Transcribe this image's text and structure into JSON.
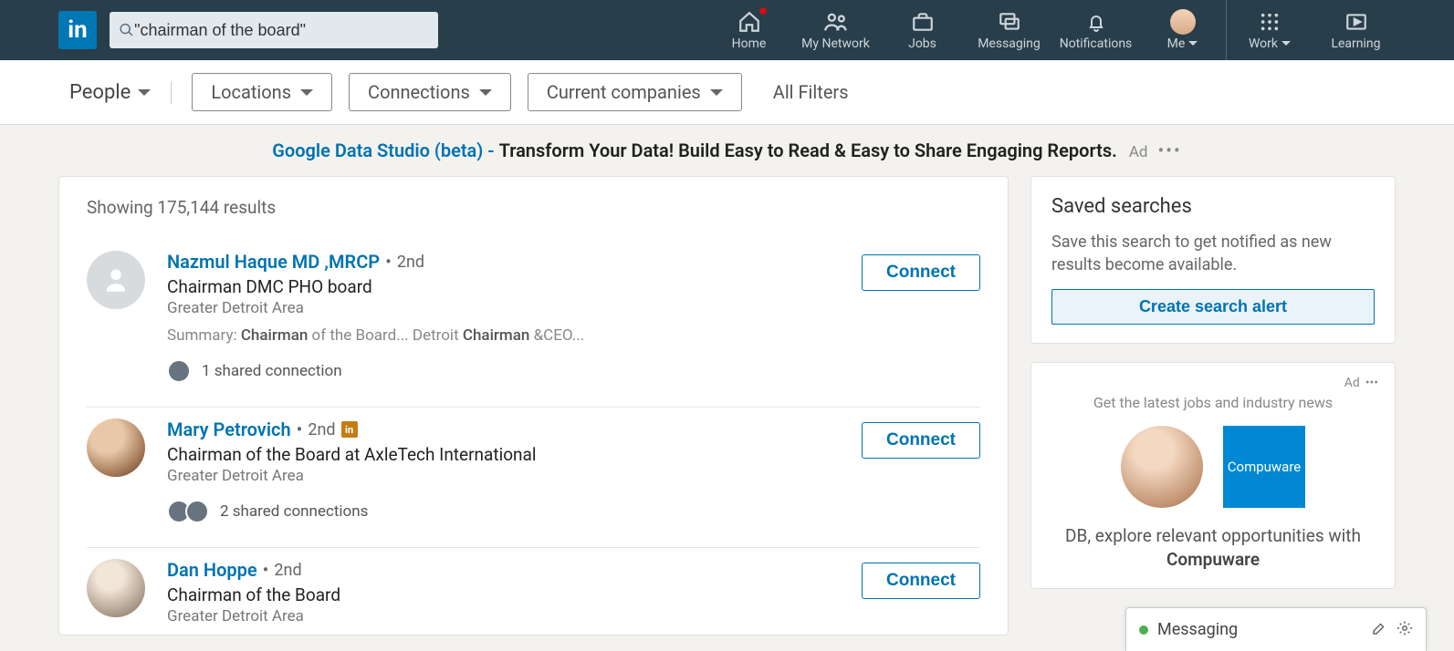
{
  "logo_text": "in",
  "search": {
    "value": "\"chairman of the board\""
  },
  "nav": {
    "home": "Home",
    "network": "My Network",
    "jobs": "Jobs",
    "messaging": "Messaging",
    "notifications": "Notifications",
    "me": "Me",
    "work": "Work",
    "learning": "Learning"
  },
  "filters": {
    "primary": "People",
    "pills": [
      "Locations",
      "Connections",
      "Current companies"
    ],
    "all": "All Filters"
  },
  "ad_strip": {
    "link": "Google Data Studio (beta) -",
    "text": " Transform Your Data! Build Easy to Read & Easy to Share Engaging Reports.",
    "tag": "Ad"
  },
  "results_header": "Showing 175,144 results",
  "connect_label": "Connect",
  "results": [
    {
      "name": "Nazmul Haque MD ,MRCP",
      "degree": "2nd",
      "headline": "Chairman DMC PHO board",
      "location": "Greater Detroit Area",
      "summary_prefix": "Summary: ",
      "summary_b1": "Chairman",
      "summary_mid": " of the Board... Detroit ",
      "summary_b2": "Chairman",
      "summary_suffix": " &CEO...",
      "shared": "1 shared connection",
      "shared_count": 1,
      "premium": false,
      "photo": false
    },
    {
      "name": "Mary Petrovich",
      "degree": "2nd",
      "headline": "Chairman of the Board at AxleTech International",
      "location": "Greater Detroit Area",
      "shared": "2 shared connections",
      "shared_count": 2,
      "premium": true,
      "photo": true
    },
    {
      "name": "Dan Hoppe",
      "degree": "2nd",
      "headline": "Chairman of the Board",
      "location": "Greater Detroit Area",
      "premium": false,
      "photo": true
    }
  ],
  "saved": {
    "title": "Saved searches",
    "desc": "Save this search to get notified as new results become available.",
    "button": "Create search alert"
  },
  "side_ad": {
    "tag": "Ad",
    "sub": "Get the latest jobs and industry news",
    "logo_text": "Compuware",
    "line": "DB, explore relevant opportunities with ",
    "company": "Compuware"
  },
  "dock": {
    "label": "Messaging"
  }
}
